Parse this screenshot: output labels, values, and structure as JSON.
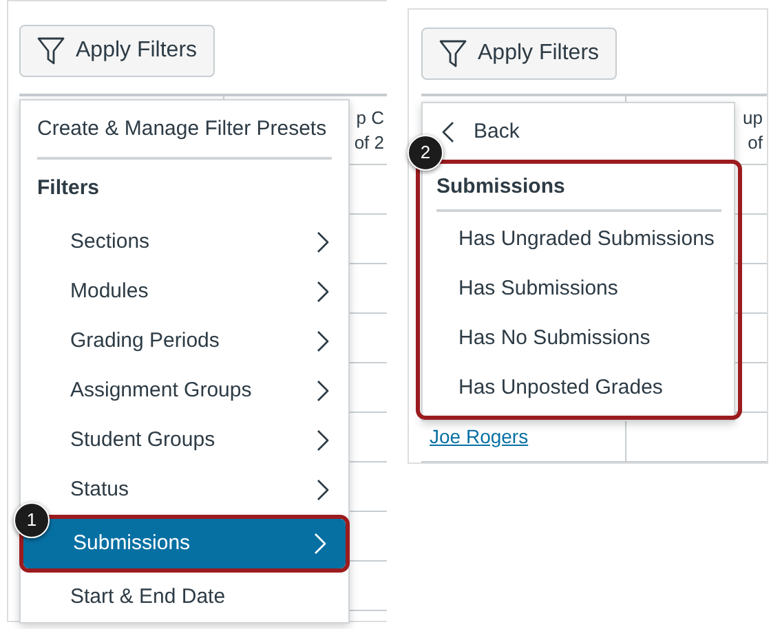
{
  "panels": [
    {
      "button": {
        "label": "Apply Filters"
      },
      "table": {
        "header_fragments": [
          "p C",
          "of 2"
        ]
      },
      "menu": {
        "kind": "main",
        "header": "Create & Manage Filter Presets",
        "section": "Filters",
        "items": [
          {
            "label": "Sections",
            "submenu": true,
            "selected": false,
            "highlighted": false
          },
          {
            "label": "Modules",
            "submenu": true,
            "selected": false,
            "highlighted": false
          },
          {
            "label": "Grading Periods",
            "submenu": true,
            "selected": false,
            "highlighted": false
          },
          {
            "label": "Assignment Groups",
            "submenu": true,
            "selected": false,
            "highlighted": false
          },
          {
            "label": "Student Groups",
            "submenu": true,
            "selected": false,
            "highlighted": false
          },
          {
            "label": "Status",
            "submenu": true,
            "selected": false,
            "highlighted": false
          },
          {
            "label": "Submissions",
            "submenu": true,
            "selected": true,
            "highlighted": true,
            "callout": "1"
          },
          {
            "label": "Start & End Date",
            "submenu": false,
            "selected": false,
            "highlighted": false
          }
        ]
      }
    },
    {
      "button": {
        "label": "Apply Filters"
      },
      "table": {
        "header_fragments": [
          "up",
          "of"
        ],
        "rows": [
          {
            "name": "Joe Rogers"
          }
        ]
      },
      "menu": {
        "kind": "submenu",
        "back": "Back",
        "section": "Submissions",
        "highlighted": true,
        "callout": "2",
        "items": [
          {
            "label": "Has Ungraded Submissions",
            "selected": false
          },
          {
            "label": "Has Submissions",
            "selected": false
          },
          {
            "label": "Has No Submissions",
            "selected": false
          },
          {
            "label": "Has Unposted Grades",
            "selected": false
          }
        ]
      }
    }
  ]
}
